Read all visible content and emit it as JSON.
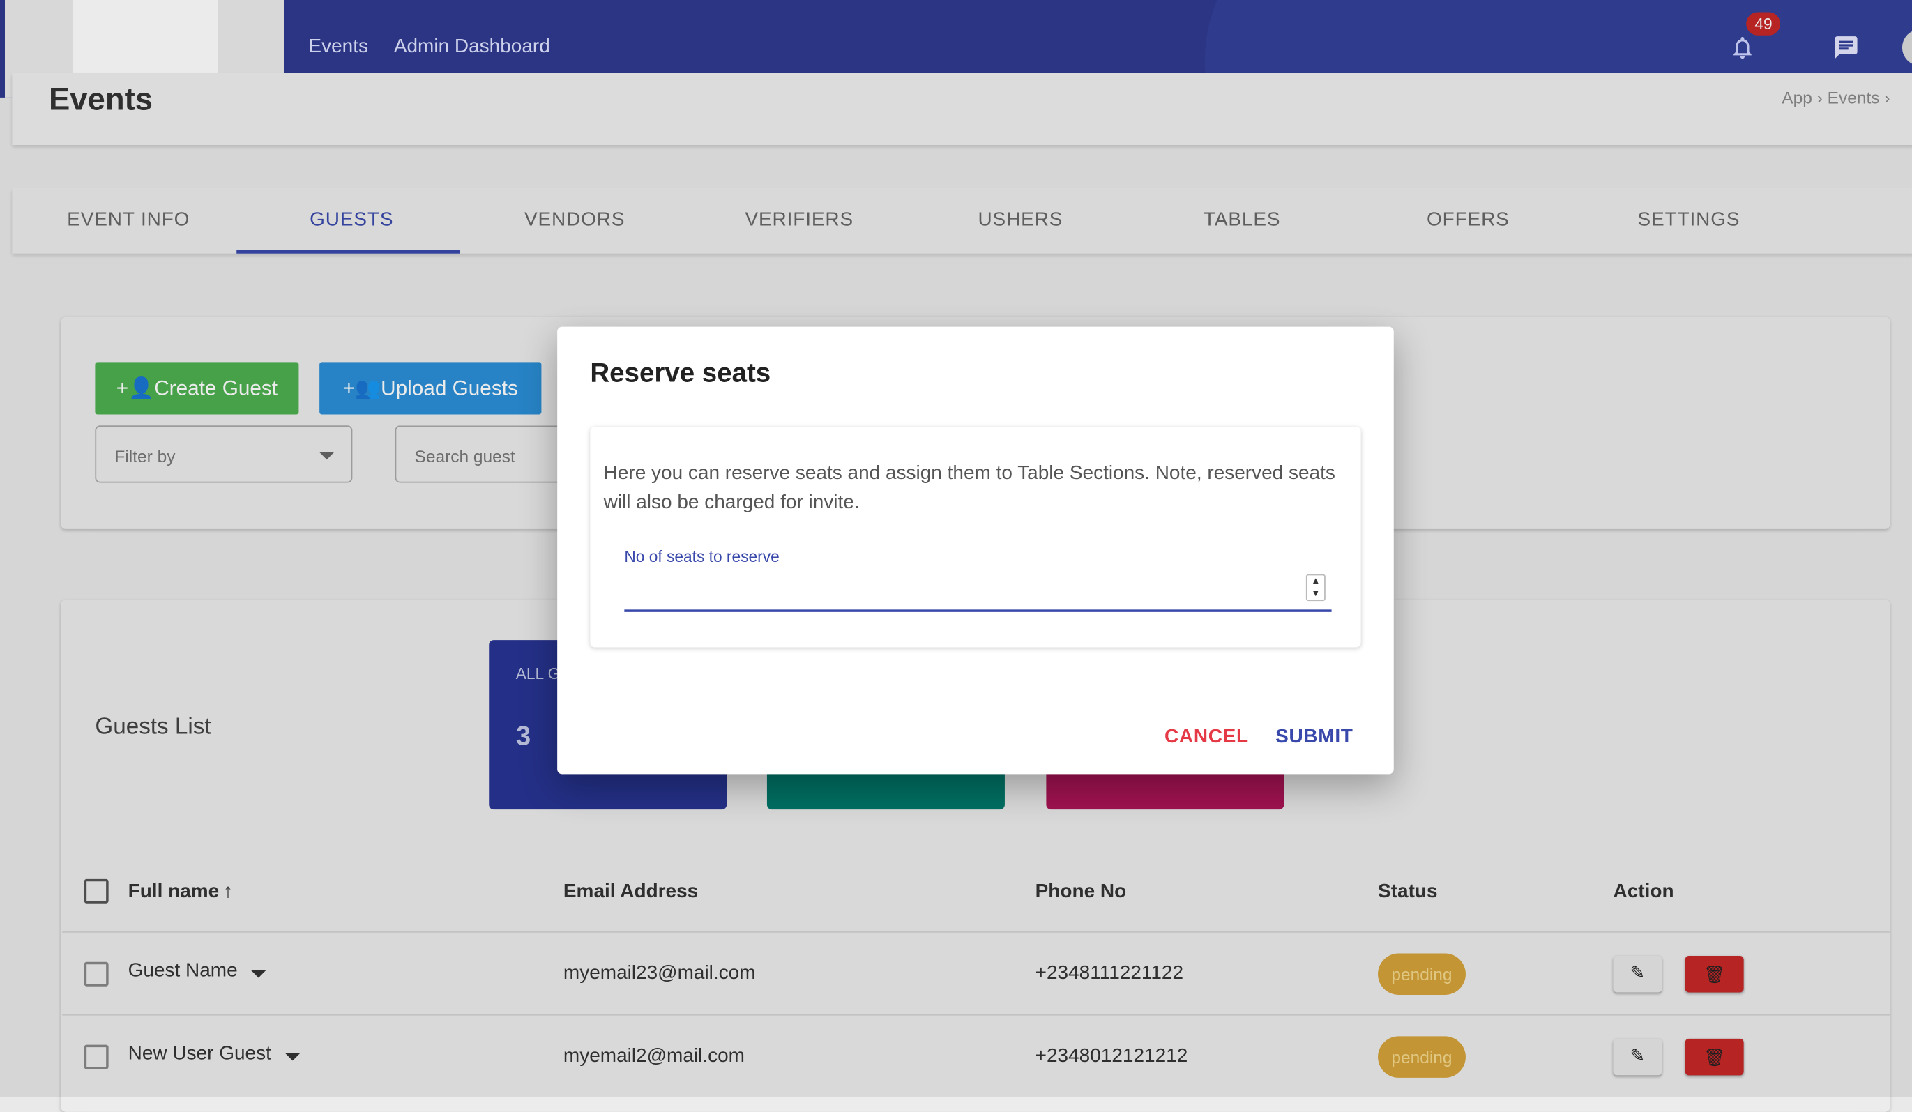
{
  "topbar": {
    "nav": [
      "Events",
      "Admin Dashboard"
    ],
    "notifications_count": "49",
    "icons": {
      "bell": "bell-icon",
      "chat": "chat-icon"
    }
  },
  "page": {
    "title": "Events",
    "breadcrumb": [
      "App",
      "Events"
    ]
  },
  "tabs": [
    "EVENT INFO",
    "GUESTS",
    "VENDORS",
    "VERIFIERS",
    "USHERS",
    "TABLES",
    "OFFERS",
    "SETTINGS"
  ],
  "active_tab": "GUESTS",
  "toolbar": {
    "create_label": "Create Guest",
    "upload_label": "Upload Guests",
    "filter_placeholder": "Filter by",
    "search_placeholder": "Search guest"
  },
  "guests_list": {
    "title": "Guests List",
    "stat_label": "ALL G",
    "stat_value": "3"
  },
  "table": {
    "columns": [
      "Full name",
      "Email Address",
      "Phone No",
      "Status",
      "Action"
    ],
    "rows": [
      {
        "name": "Guest Name",
        "email": "myemail23@mail.com",
        "phone": "+2348111221122",
        "status": "pending"
      },
      {
        "name": "New User Guest",
        "email": "myemail2@mail.com",
        "phone": "+2348012121212",
        "status": "pending"
      }
    ]
  },
  "modal": {
    "title": "Reserve seats",
    "description": "Here you can reserve seats and assign them to Table Sections. Note, reserved seats will also be charged for invite.",
    "field_label": "No of seats to reserve",
    "field_value": "",
    "cancel_label": "CANCEL",
    "submit_label": "SUBMIT"
  },
  "colors": {
    "topbar": "#2f3a8f",
    "accent": "#3949ab",
    "create_button": "#4caf50",
    "upload_button": "#2b8fd6",
    "cancel": "#e53946",
    "pending": "#d4a23a",
    "delete": "#c62828"
  }
}
